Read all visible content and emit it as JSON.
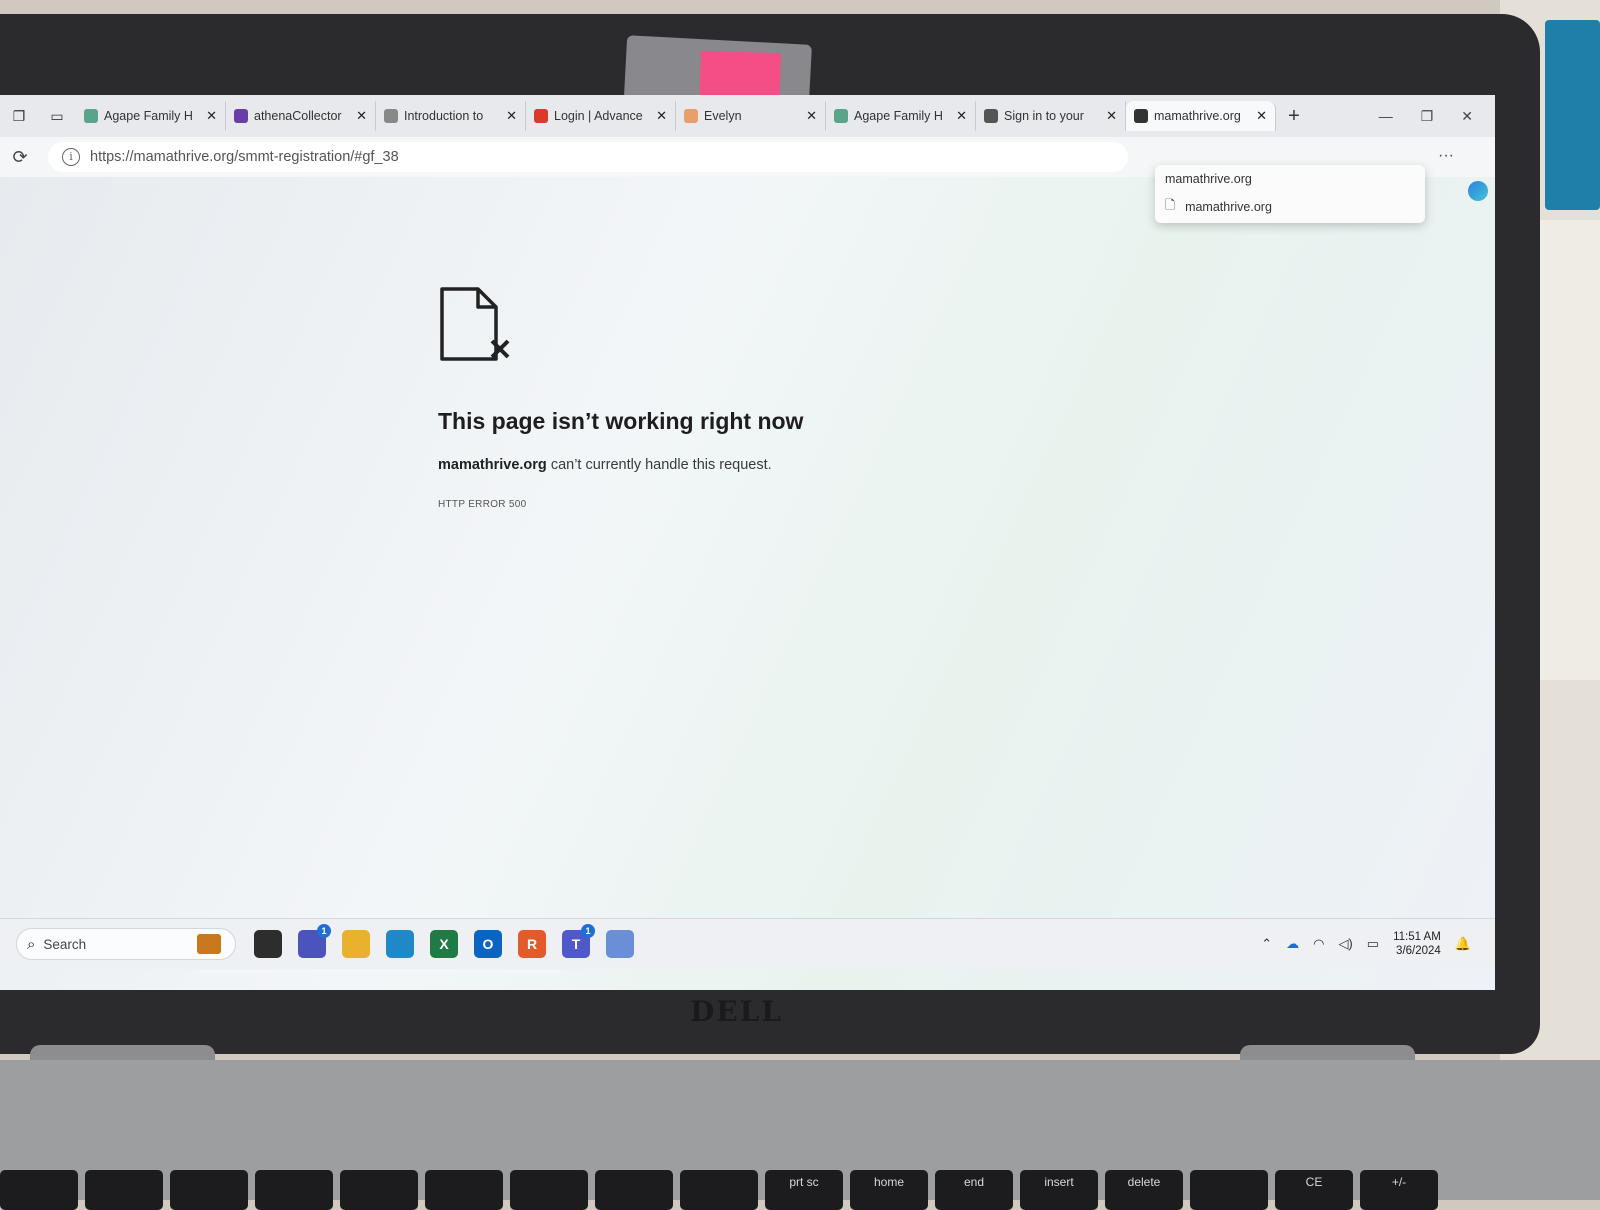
{
  "browser": {
    "tabs": [
      {
        "label": "Agape Family H",
        "favicon": "globe-icon",
        "color": "#5aa58a"
      },
      {
        "label": "athenaCollector",
        "favicon": "athena-icon",
        "color": "#6a3ea8"
      },
      {
        "label": "Introduction to",
        "favicon": "page-icon",
        "color": "#888888"
      },
      {
        "label": "Login | Advance",
        "favicon": "advance-icon",
        "color": "#d93a2a"
      },
      {
        "label": "Evelyn",
        "favicon": "evelyn-icon",
        "color": "#e8a06a"
      },
      {
        "label": "Agape Family H",
        "favicon": "globe-icon",
        "color": "#5aa58a"
      },
      {
        "label": "Sign in to your",
        "favicon": "signin-icon",
        "color": "#555555"
      },
      {
        "label": "mamathrive.org",
        "favicon": "error-page-icon",
        "color": "#333333"
      }
    ],
    "active_tab": 7,
    "new_tab_glyph": "+",
    "close_glyph": "✕",
    "url": "https://mamathrive.org/smmt-registration/#gf_38",
    "tooltip": {
      "title": "mamathrive.org",
      "item": "mamathrive.org"
    }
  },
  "error_page": {
    "heading": "This page isn’t working right now",
    "host": "mamathrive.org",
    "message": " can’t currently handle this request.",
    "code": "HTTP ERROR 500"
  },
  "taskbar": {
    "search_label": "Search",
    "apps": [
      {
        "name": "task-view-icon",
        "color": "#2d2d2d",
        "glyph": ""
      },
      {
        "name": "teams-chat-icon",
        "color": "#4b53bc",
        "glyph": "",
        "badge": "1"
      },
      {
        "name": "file-explorer-icon",
        "color": "#e9b12e",
        "glyph": ""
      },
      {
        "name": "edge-icon",
        "color": "#1e88c8",
        "glyph": ""
      },
      {
        "name": "excel-icon",
        "color": "#1f7a45",
        "glyph": "X"
      },
      {
        "name": "outlook-icon",
        "color": "#0a64c2",
        "glyph": "O"
      },
      {
        "name": "r-app-icon",
        "color": "#e35b2a",
        "glyph": "R"
      },
      {
        "name": "teams-icon",
        "color": "#5059c9",
        "glyph": "T",
        "badge": "1"
      },
      {
        "name": "snipping-tool-icon",
        "color": "#6b8fd6",
        "glyph": ""
      }
    ],
    "time": "11:51 AM",
    "date": "3/6/2024"
  },
  "hardware": {
    "brand": "DELL",
    "keys": [
      "",
      "",
      "",
      "",
      "",
      "",
      "",
      "",
      "",
      "prt sc",
      "home",
      "end",
      "insert",
      "delete",
      "",
      "CE",
      "+/-"
    ]
  }
}
